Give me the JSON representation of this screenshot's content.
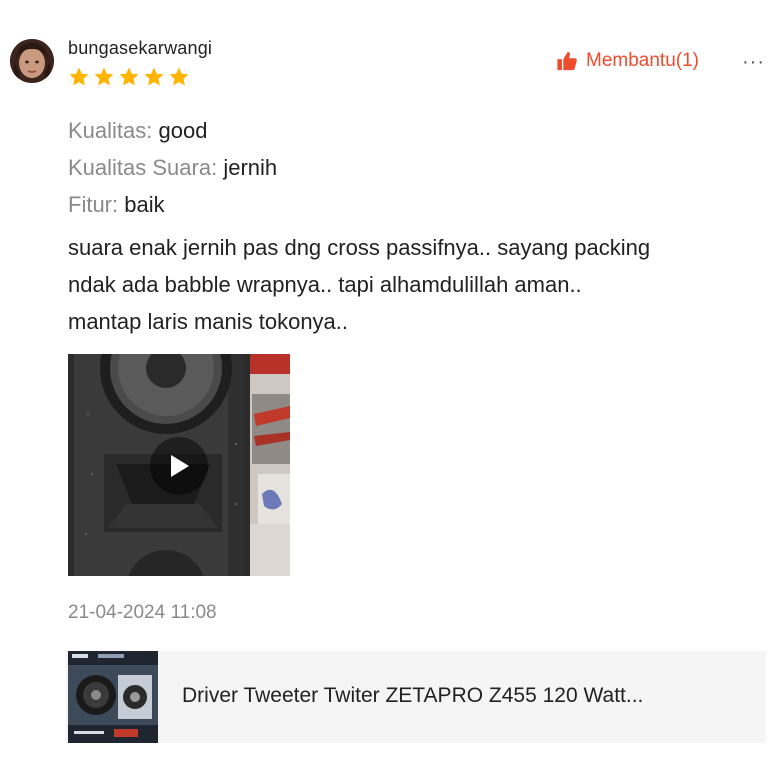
{
  "review": {
    "username": "bungasekarwangi",
    "rating": 5,
    "rating_max": 5,
    "helpful": {
      "icon": "thumbs-up-icon",
      "label": "Membantu(1)"
    },
    "more_icon": "more-options-icon",
    "more_glyph": "···",
    "attributes": [
      {
        "key": "Kualitas:",
        "value": "good"
      },
      {
        "key": "Kualitas Suara:",
        "value": "jernih"
      },
      {
        "key": "Fitur:",
        "value": "baik"
      }
    ],
    "body_lines": [
      "suara enak jernih pas dng cross passifnya.. sayang packing",
      "ndak ada babble wrapnya.. tapi alhamdulillah aman..",
      "mantap laris manis tokonya.."
    ],
    "media": {
      "type": "video",
      "icon": "play-icon"
    },
    "timestamp": "21-04-2024 11:08"
  },
  "product": {
    "name": "Driver Tweeter Twiter ZETAPRO Z455 120 Watt..."
  },
  "colors": {
    "accent": "#ee4d2d",
    "star": "#ffb400",
    "muted_text": "#8a8a8a",
    "card_bg": "#f5f5f5"
  }
}
